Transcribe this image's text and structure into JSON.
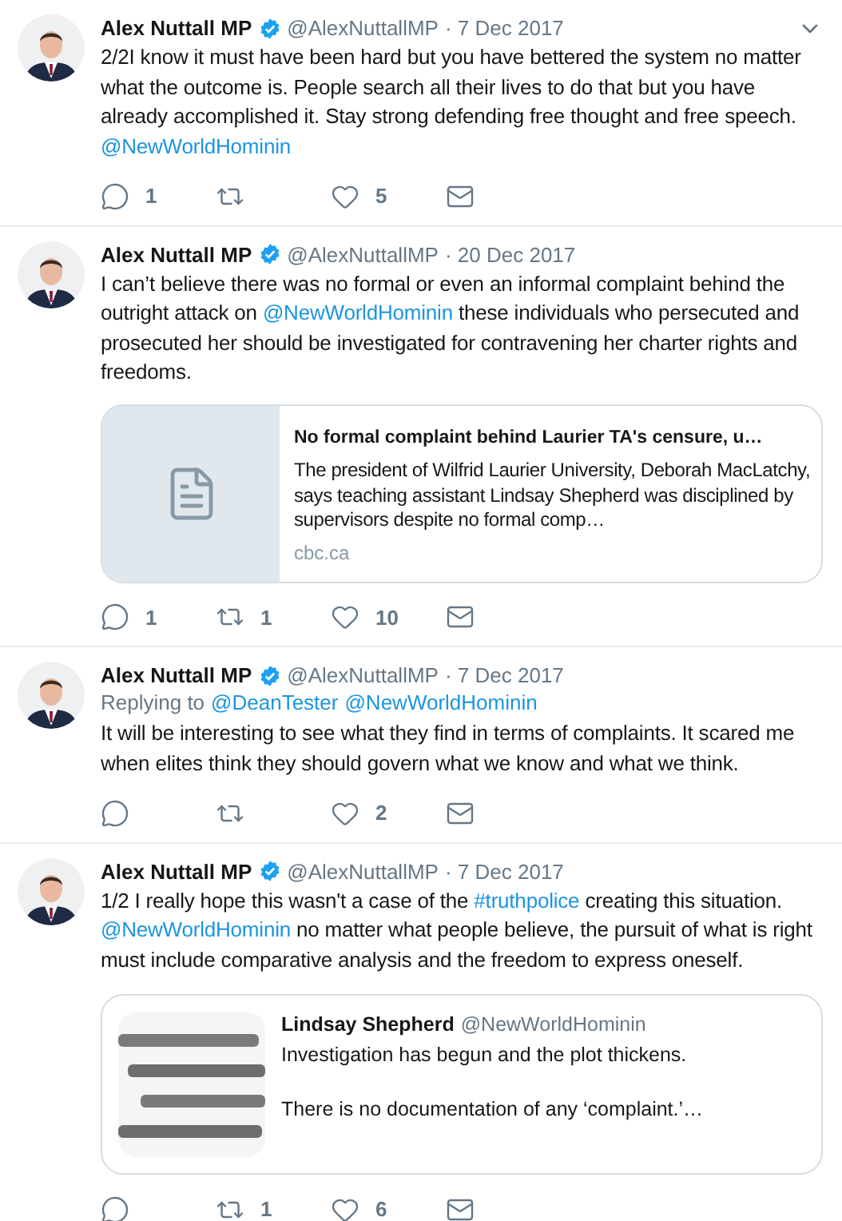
{
  "tweets": [
    {
      "author": "Alex Nuttall MP",
      "verified": true,
      "handle": "@AlexNuttallMP",
      "date": "· 7 Dec 2017",
      "menu": true,
      "body": [
        {
          "kind": "text",
          "text": "2/2I know it must have been hard but you have bettered the system no matter what the outcome is. People search all their lives to do that but you have already accomplished it. Stay strong defending free thought and free speech.\n"
        },
        {
          "kind": "link",
          "text": "@NewWorldHominin"
        }
      ],
      "actions": {
        "replies": "1",
        "likes": "5"
      }
    },
    {
      "author": "Alex Nuttall MP",
      "verified": true,
      "handle": "@AlexNuttallMP",
      "date": "· 20 Dec 2017",
      "menu": false,
      "body": [
        {
          "kind": "text",
          "text": "I can’t believe there was no formal or even an informal complaint behind the outright attack on "
        },
        {
          "kind": "link",
          "text": "@NewWorldHominin"
        },
        {
          "kind": "text",
          "text": " these individuals who persecuted and prosecuted her should be investigated for contravening her charter rights and freedoms."
        }
      ],
      "card": {
        "kind": "link",
        "title": "No formal complaint behind Laurier TA's censure, u…",
        "description": "The president of Wilfrid Laurier University, Deborah MacLatchy, says teaching assistant Lindsay Shepherd was disciplined by supervisors despite no formal comp…",
        "domain": "cbc.ca"
      },
      "actions": {
        "replies": "1",
        "retweets": "1",
        "likes": "10"
      }
    },
    {
      "author": "Alex Nuttall MP",
      "verified": true,
      "handle": "@AlexNuttallMP",
      "date": "· 7 Dec 2017",
      "menu": false,
      "reply_label": "Replying to",
      "reply_to": [
        "@DeanTester",
        "@NewWorldHominin"
      ],
      "body": [
        {
          "kind": "text",
          "text": "It will be interesting to see what they find in terms of complaints. It scared me when elites think they should govern what we know and what we think."
        }
      ],
      "actions": {
        "likes": "2"
      }
    },
    {
      "author": "Alex Nuttall MP",
      "verified": true,
      "handle": "@AlexNuttallMP",
      "date": "· 7 Dec 2017",
      "menu": false,
      "body": [
        {
          "kind": "text",
          "text": "1/2 I really hope this wasn't a case of the "
        },
        {
          "kind": "link",
          "text": "#truthpolice"
        },
        {
          "kind": "text",
          "text": " creating this situation.\n"
        },
        {
          "kind": "link",
          "text": "@NewWorldHominin"
        },
        {
          "kind": "text",
          "text": " no matter what people believe, the pursuit of what is right must include comparative analysis and the freedom to express oneself."
        }
      ],
      "card": {
        "kind": "quote",
        "name": "Lindsay Shepherd",
        "handle": "@NewWorldHominin",
        "description": "Investigation has begun and the plot thickens.\n\nThere is no documentation of any ‘complaint.’…"
      },
      "actions": {
        "retweets": "1",
        "likes": "6"
      }
    }
  ]
}
